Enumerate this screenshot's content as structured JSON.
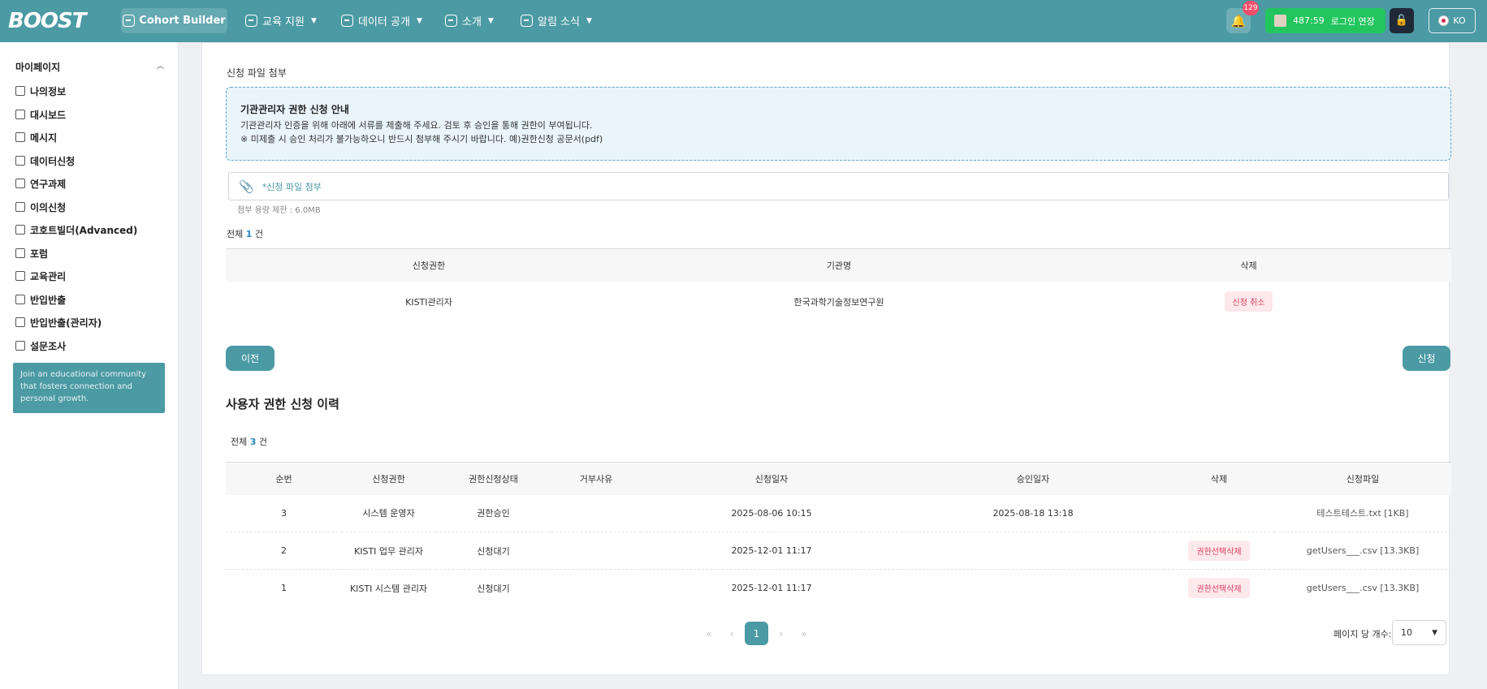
{
  "header": {
    "logo": "BOOST",
    "cohort_builder": "Cohort Builder",
    "nav": [
      {
        "label": "교육 지원"
      },
      {
        "label": "데이터 공개"
      },
      {
        "label": "소개"
      },
      {
        "label": "알림 소식"
      }
    ],
    "notification_count": "129",
    "session_time": "487:59",
    "session_extend": "로그인 연장",
    "language": "KO"
  },
  "sidebar": {
    "title": "마이페이지",
    "items": [
      {
        "label": "나의정보"
      },
      {
        "label": "대시보드"
      },
      {
        "label": "메시지"
      },
      {
        "label": "데이터신청"
      },
      {
        "label": "연구과제"
      },
      {
        "label": "이의신청"
      },
      {
        "label": "코호트빌더(Advanced)"
      },
      {
        "label": "포럼"
      },
      {
        "label": "교육관리"
      },
      {
        "label": "반입반출"
      },
      {
        "label": "반입반출(관리자)"
      },
      {
        "label": "설문조사"
      }
    ],
    "banner": "Join an educational community that fosters connection and personal growth."
  },
  "main": {
    "section_label": "신청 파일 첨부",
    "notice": {
      "title": "기관관리자 권한 신청 안내",
      "line1": "기관관리자 인증을 위해 아래에 서류를 제출해 주세요. 검토 후 승인을 통해 권한이 부여됩니다.",
      "line2": "※ 미제출 시 승인 처리가 불가능하오니 반드시 첨부해 주시기 바랍니다. 예)권한신청 공문서(pdf)"
    },
    "file_placeholder": "*신청 파일 첨부",
    "file_limit": "첨부 용량 제한 : 6.0MB",
    "request_count": {
      "prefix": "전체",
      "num": "1",
      "suffix": "건"
    },
    "request_table": {
      "headers": [
        "신청권한",
        "기관명",
        "삭제"
      ],
      "rows": [
        {
          "role": "KISTI관리자",
          "org": "한국과학기술정보연구원",
          "action": "신청 취소"
        }
      ]
    },
    "prev_button": "이전",
    "submit_button": "신청",
    "history_title": "사용자 권한 신청 이력",
    "history_count": {
      "prefix": "전체",
      "num": "3",
      "suffix": "건"
    },
    "history_table": {
      "headers": [
        "순번",
        "신청권한",
        "권한신청상태",
        "거부사유",
        "신청일자",
        "승인일자",
        "삭제",
        "신청파일"
      ],
      "rows": [
        {
          "no": "3",
          "role": "시스템 운영자",
          "status": "권한승인",
          "reason": "",
          "requested": "2025-08-06 10:15",
          "approved": "2025-08-18 13:18",
          "action": "",
          "file": "테스트테스트.txt [1KB]"
        },
        {
          "no": "2",
          "role": "KISTI 업무 관리자",
          "status": "신청대기",
          "reason": "",
          "requested": "2025-12-01 11:17",
          "approved": "",
          "action": "권한선택삭제",
          "file": "getUsers___.csv [13.3KB]"
        },
        {
          "no": "1",
          "role": "KISTI 시스템 관리자",
          "status": "신청대기",
          "reason": "",
          "requested": "2025-12-01 11:17",
          "approved": "",
          "action": "권한선택삭제",
          "file": "getUsers___.csv [13.3KB]"
        }
      ]
    },
    "pagination": {
      "current": "1"
    },
    "per_page_label": "페이지 당 개수:",
    "per_page_value": "10"
  }
}
